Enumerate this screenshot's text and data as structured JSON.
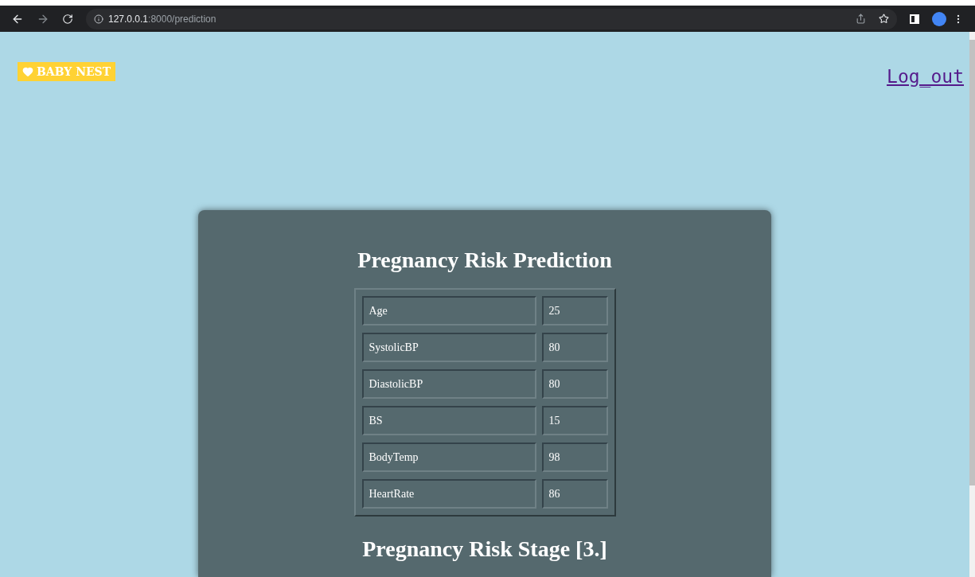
{
  "browser": {
    "address_host": "127.0.0.1",
    "address_path": ":8000/prediction"
  },
  "header": {
    "logo": "BABY NEST",
    "logout_link": "Log_out"
  },
  "card": {
    "title": "Pregnancy Risk Prediction",
    "rows": [
      {
        "label": "Age",
        "value": "25"
      },
      {
        "label": "SystolicBP",
        "value": "80"
      },
      {
        "label": "DiastolicBP",
        "value": "80"
      },
      {
        "label": "BS",
        "value": "15"
      },
      {
        "label": "BodyTemp",
        "value": "98"
      },
      {
        "label": "HeartRate",
        "value": "86"
      }
    ],
    "result": "Pregnancy Risk Stage [3.]"
  }
}
